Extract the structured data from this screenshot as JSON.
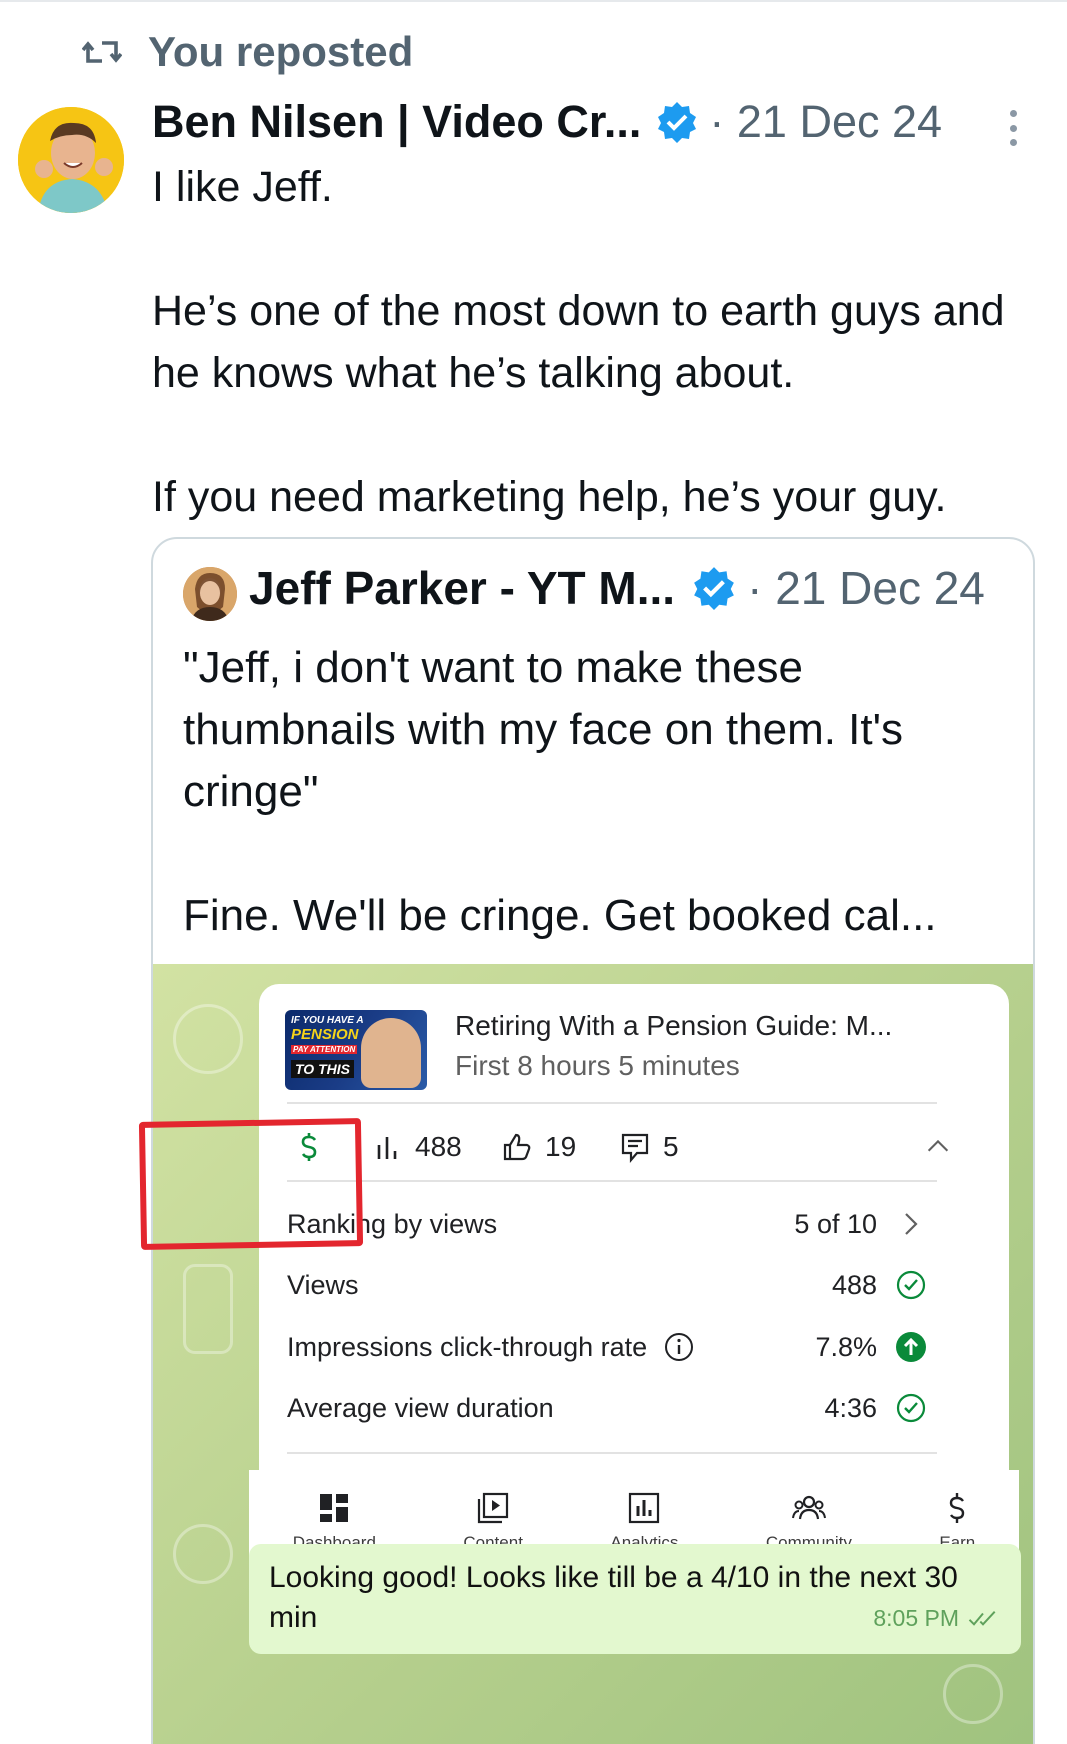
{
  "repost": {
    "label": "You reposted",
    "icon": "repost-icon"
  },
  "tweet": {
    "author_name": "Ben Nilsen | Video Cr...",
    "date": "· 21 Dec 24",
    "text": [
      "I like Jeff.",
      "",
      "He’s one of the most down to earth guys and he knows what he’s talking about.",
      "",
      "If you need marketing help, he’s your guy."
    ]
  },
  "quote": {
    "author_name": "Jeff Parker - YT M...",
    "date": "· 21 Dec 24",
    "text": [
      "\"Jeff, i don't want to make these thumbnails with my face on them. It's cringe\"",
      "",
      "Fine. We'll be cringe. Get booked cal..."
    ]
  },
  "screenshot": {
    "thumbnail_text": [
      "IF YOU HAVE A",
      "PENSION",
      "PAY ATTENTION",
      "TO THIS"
    ],
    "video_title": "Retiring With a Pension Guide: M...",
    "video_subtitle": "First 8 hours 5 minutes",
    "stats": {
      "views": "488",
      "likes": "19",
      "comments": "5"
    },
    "metrics": [
      {
        "label": "Ranking by views",
        "value": "5 of 10",
        "icon": "chevron-right-icon"
      },
      {
        "label": "Views",
        "value": "488",
        "icon": "check-circle-icon"
      },
      {
        "label": "Impressions click-through rate",
        "value": "7.8%",
        "icon": "arrow-up-circle-icon"
      },
      {
        "label": "Average view duration",
        "value": "4:36",
        "icon": "check-circle-icon"
      }
    ],
    "nav": [
      {
        "label": "Dashboard",
        "icon": "dashboard-icon"
      },
      {
        "label": "Content",
        "icon": "content-icon"
      },
      {
        "label": "Analytics",
        "icon": "analytics-icon"
      },
      {
        "label": "Community",
        "icon": "community-icon"
      },
      {
        "label": "Earn",
        "icon": "dollar-icon"
      }
    ],
    "chat": {
      "text": "Looking good!  Looks like till be a 4/10 in the next 30 min",
      "time": "8:05 PM"
    }
  },
  "colors": {
    "verified": "#1d9bf0",
    "secondary_text": "#536471",
    "annotation_red": "#e3262e",
    "chat_bubble": "#e3f8cf",
    "success_green": "#0a8a3a"
  }
}
